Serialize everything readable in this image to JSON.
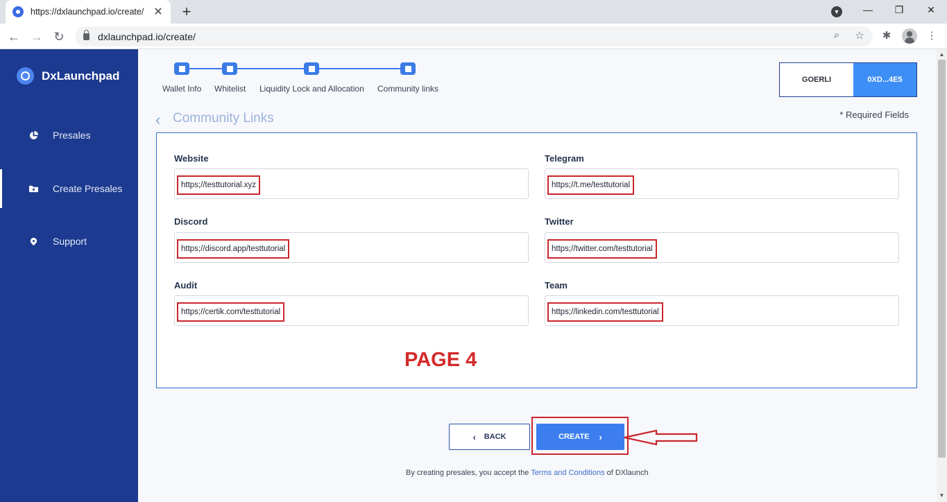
{
  "browser": {
    "tab_title": "https://dxlaunchpad.io/create/",
    "tab_close": "✕",
    "new_tab": "+",
    "url": "dxlaunchpad.io/create/",
    "profile_badge": "▼",
    "window_controls": {
      "minimize": "—",
      "restore": "❐",
      "close": "✕"
    },
    "nav": {
      "back": "←",
      "forward": "→",
      "reload": "↻"
    },
    "icons": {
      "zoom": "search-icon",
      "bookmark": "star-icon",
      "extensions": "puzzle-icon",
      "menu": "kebab-menu-icon"
    },
    "icon_glyphs": {
      "zoom": "⌕",
      "bookmark": "☆",
      "extensions": "✱",
      "menu": "⋮"
    }
  },
  "sidebar": {
    "brand": "DxLaunchpad",
    "items": [
      {
        "label": "Presales",
        "icon": "pie-chart-icon",
        "active": false
      },
      {
        "label": "Create Presales",
        "icon": "folder-plus-icon",
        "active": true
      },
      {
        "label": "Support",
        "icon": "help-icon",
        "active": false
      }
    ]
  },
  "stepper": {
    "steps": [
      {
        "label": "Wallet Info",
        "icon": "wallet-icon"
      },
      {
        "label": "Whitelist",
        "icon": "clipboard-icon"
      },
      {
        "label": "Liquidity Lock and Allocation",
        "icon": "shield-icon"
      },
      {
        "label": "Community links",
        "icon": "community-icon"
      }
    ]
  },
  "network": {
    "name": "GOERLI",
    "address": "0XD...4E5"
  },
  "page": {
    "title": "Community Links",
    "required_note": "* Required Fields",
    "annotation": "PAGE 4"
  },
  "fields": [
    {
      "label": "Website",
      "value": "https;//testtutorial.xyz"
    },
    {
      "label": "Telegram",
      "value": "https;//t.me/testtutorial"
    },
    {
      "label": "Discord",
      "value": "https;//discord.app/testtutorial"
    },
    {
      "label": "Twitter",
      "value": "https;//twitter.com/testtutorial"
    },
    {
      "label": "Audit",
      "value": "https;//certik.com/testtutorial"
    },
    {
      "label": "Team",
      "value": "https;//linkedin.com/testtutorial"
    }
  ],
  "actions": {
    "back_label": "BACK",
    "create_label": "CREATE",
    "chev_left": "‹",
    "chev_right": "›"
  },
  "footer": {
    "prefix": "By creating presales, you accept the ",
    "link": "Terms and Conditions",
    "suffix": " of DXlaunch"
  },
  "colors": {
    "sidebar": "#1c3a8f",
    "accent": "#3b7be6",
    "highlight": "#c8262c"
  }
}
